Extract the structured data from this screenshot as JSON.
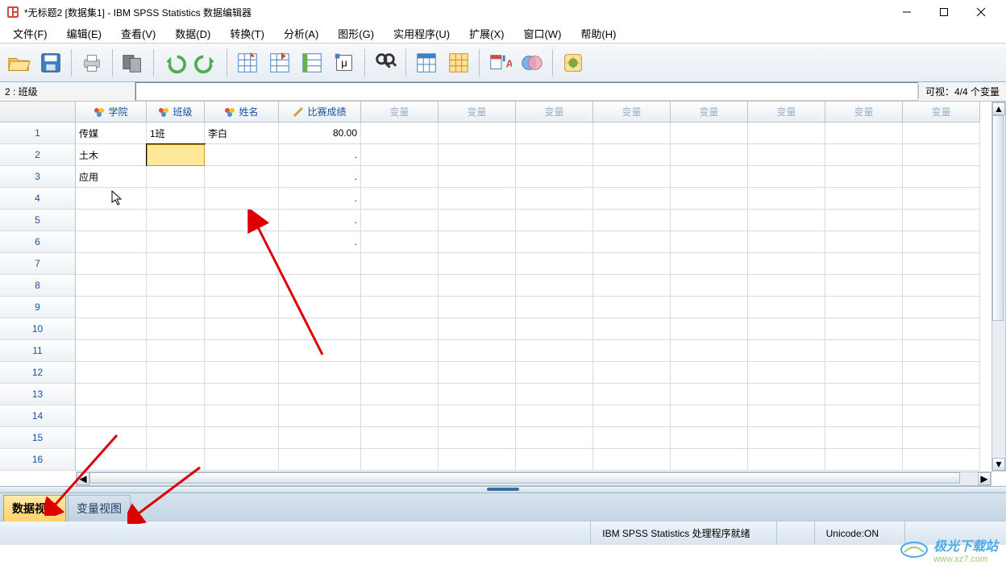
{
  "title": "*无标题2 [数据集1] - IBM SPSS Statistics 数据编辑器",
  "menu": [
    "文件(F)",
    "编辑(E)",
    "查看(V)",
    "数据(D)",
    "转换(T)",
    "分析(A)",
    "图形(G)",
    "实用程序(U)",
    "扩展(X)",
    "窗口(W)",
    "帮助(H)"
  ],
  "infobar": {
    "left": "2 : 班级",
    "right": "可视：4/4 个变量"
  },
  "columns": {
    "c1": "学院",
    "c2": "班级",
    "c3": "姓名",
    "c4": "比赛成绩",
    "empty": "变量"
  },
  "rows": [
    "1",
    "2",
    "3",
    "4",
    "5",
    "6",
    "7",
    "8",
    "9",
    "10",
    "11",
    "12",
    "13",
    "14",
    "15",
    "16"
  ],
  "data": {
    "r1": {
      "c1": "传媒",
      "c2": "1班",
      "c3": "李白",
      "c4": "80.00"
    },
    "r2": {
      "c1": "土木",
      "c4": "."
    },
    "r3": {
      "c1": "应用",
      "c4": "."
    },
    "r4": {
      "c4": "."
    },
    "r5": {
      "c4": "."
    },
    "r6": {
      "c4": "."
    }
  },
  "tabs": {
    "active": "数据视图",
    "inactive": "变量视图"
  },
  "status": {
    "msg": "IBM SPSS Statistics 处理程序就绪",
    "unicode": "Unicode:ON"
  },
  "watermark": {
    "t1": "极光下载站",
    "t2": "www.xz7.com"
  }
}
